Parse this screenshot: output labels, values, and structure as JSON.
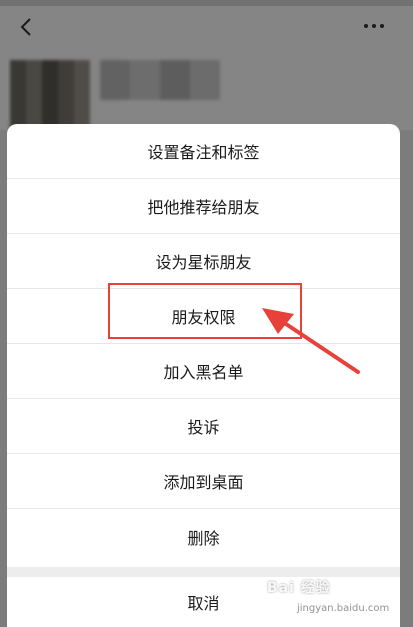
{
  "menu": {
    "items": [
      "设置备注和标签",
      "把他推荐给朋友",
      "设为星标朋友",
      "朋友权限",
      "加入黑名单",
      "投诉",
      "添加到桌面",
      "删除"
    ],
    "cancel": "取消",
    "highlighted_index": 3
  },
  "watermark": {
    "brand": "Bai 经验",
    "url": "jingyan.baidu.com"
  },
  "colors": {
    "highlight": "#e8413a",
    "overlay": "rgba(0,0,0,0.48)",
    "sheet_bg": "#ffffff",
    "divider": "#e6e6e6"
  },
  "icons": {
    "back": "chevron-left-icon",
    "more": "more-dots-icon",
    "annotation_arrow": "red-arrow-icon"
  }
}
